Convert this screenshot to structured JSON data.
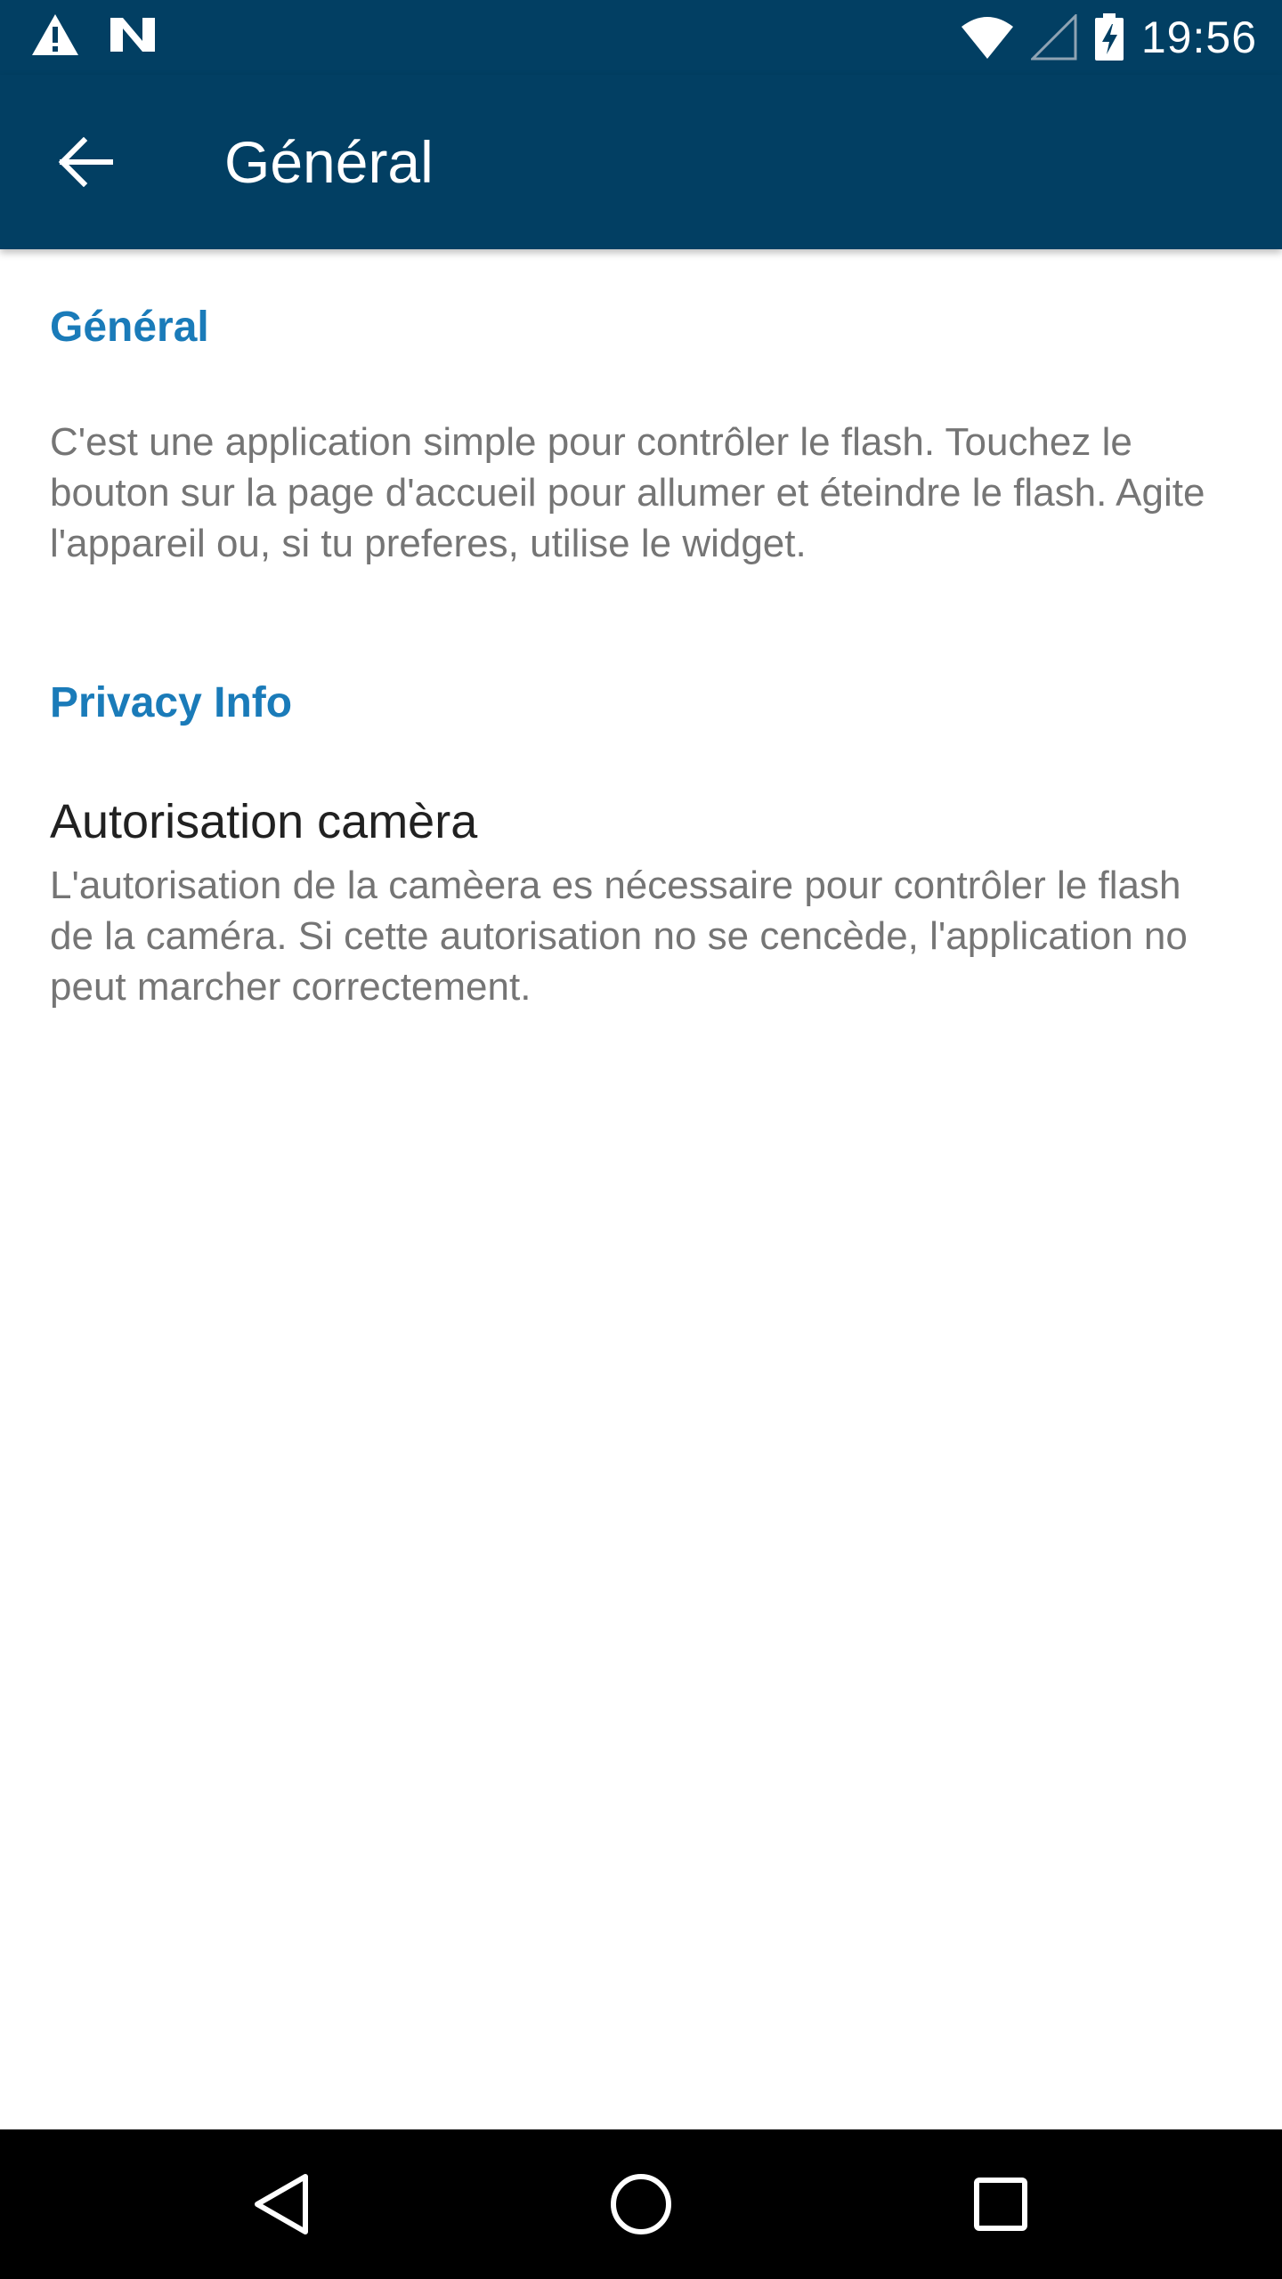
{
  "status_bar": {
    "time": "19:56",
    "icons": [
      "warning-icon",
      "n-notification-icon",
      "wifi-icon",
      "cell-signal-icon",
      "battery-charging-icon"
    ]
  },
  "app_bar": {
    "title": "Général",
    "back_icon": "arrow-back-icon"
  },
  "sections": {
    "general": {
      "header": "Général",
      "description": "C'est une application simple pour contrôler le flash. Touchez le bouton sur la page d'accueil pour allumer et éteindre le flash. Agite l'appareil ou, si tu preferes, utilise le widget."
    },
    "privacy": {
      "header": "Privacy Info",
      "item_title": "Autorisation camèra",
      "item_summary": "L'autorisation de la camèera es nécessaire pour contrôler le flash de la caméra. Si cette autorisation no se cencède, l'application no peut marcher correctement."
    }
  },
  "nav_bar": {
    "buttons": [
      "back-triangle-icon",
      "home-circle-icon",
      "recents-square-icon"
    ]
  },
  "colors": {
    "primary_dark": "#023f63",
    "accent": "#1a7bb9",
    "secondary_text": "#757575",
    "primary_text": "#212121"
  }
}
